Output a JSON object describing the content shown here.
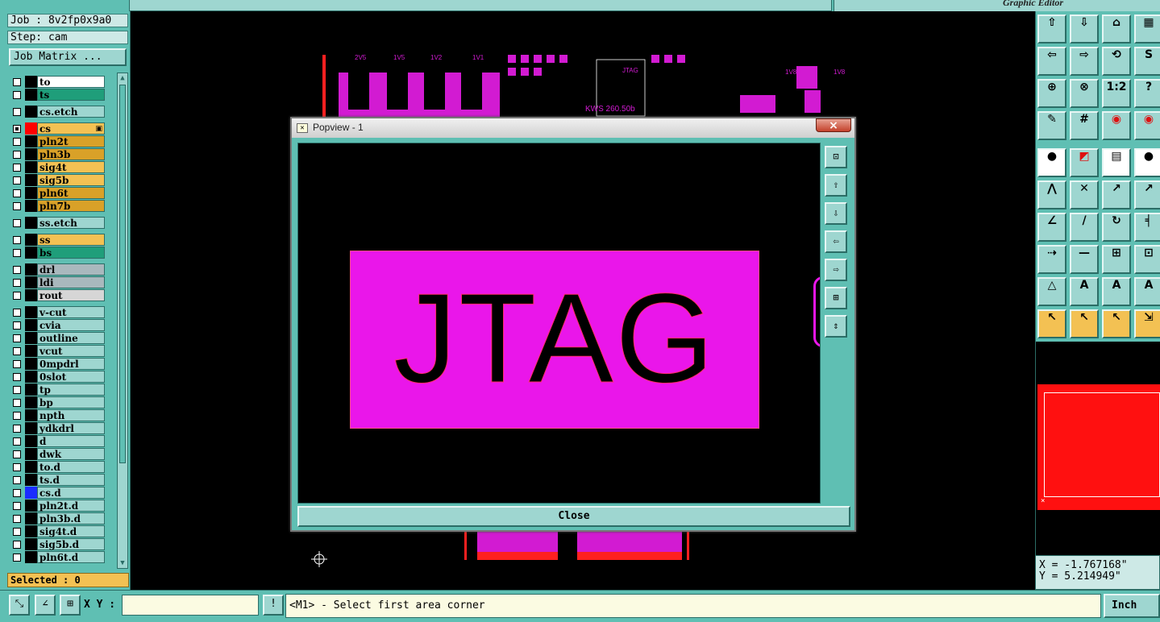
{
  "header": {
    "app_title": "Graphic Editor"
  },
  "job": {
    "job_label": "Job : 8v2fp0x9a0",
    "step_label": "Step: cam",
    "matrix_button": "Job Matrix ..."
  },
  "layers": [
    {
      "name": "to",
      "color": "#ffffff",
      "swatch": "#000000",
      "checked": false
    },
    {
      "name": "ts",
      "color": "#1f9e7a",
      "swatch": "#000000",
      "checked": false
    },
    {
      "name": "cs.etch",
      "color": "#9ed6d0",
      "swatch": "#000000",
      "checked": false
    },
    {
      "name": "cs",
      "color": "#f3c153",
      "swatch": "#ff0000",
      "checked": true,
      "flag": "▣"
    },
    {
      "name": "pln2t",
      "color": "#d9a128",
      "swatch": "#000000",
      "checked": false
    },
    {
      "name": "pln3b",
      "color": "#d9a128",
      "swatch": "#000000",
      "checked": false
    },
    {
      "name": "sig4t",
      "color": "#f3c153",
      "swatch": "#000000",
      "checked": false
    },
    {
      "name": "sig5b",
      "color": "#f3c153",
      "swatch": "#000000",
      "checked": false
    },
    {
      "name": "pln6t",
      "color": "#d9a128",
      "swatch": "#000000",
      "checked": false
    },
    {
      "name": "pln7b",
      "color": "#d9a128",
      "swatch": "#000000",
      "checked": false
    },
    {
      "name": "ss.etch",
      "color": "#9ed6d0",
      "swatch": "#000000",
      "checked": false
    },
    {
      "name": "ss",
      "color": "#f3c153",
      "swatch": "#000000",
      "checked": false
    },
    {
      "name": "bs",
      "color": "#1f9e7a",
      "swatch": "#000000",
      "checked": false
    },
    {
      "name": "drl",
      "color": "#a9b8bd",
      "swatch": "#000000",
      "checked": false
    },
    {
      "name": "ldi",
      "color": "#a9b8bd",
      "swatch": "#000000",
      "checked": false
    },
    {
      "name": "rout",
      "color": "#d6d6d6",
      "swatch": "#000000",
      "checked": false
    },
    {
      "name": "v-cut",
      "color": "#9ed6d0",
      "swatch": "#000000",
      "checked": false
    },
    {
      "name": "cvia",
      "color": "#9ed6d0",
      "swatch": "#000000",
      "checked": false
    },
    {
      "name": "outline",
      "color": "#9ed6d0",
      "swatch": "#000000",
      "checked": false
    },
    {
      "name": "vcut",
      "color": "#9ed6d0",
      "swatch": "#000000",
      "checked": false
    },
    {
      "name": "0mpdrl",
      "color": "#9ed6d0",
      "swatch": "#000000",
      "checked": false
    },
    {
      "name": "0slot",
      "color": "#9ed6d0",
      "swatch": "#000000",
      "checked": false
    },
    {
      "name": "tp",
      "color": "#9ed6d0",
      "swatch": "#000000",
      "checked": false
    },
    {
      "name": "bp",
      "color": "#9ed6d0",
      "swatch": "#000000",
      "checked": false
    },
    {
      "name": "npth",
      "color": "#9ed6d0",
      "swatch": "#000000",
      "checked": false
    },
    {
      "name": "ydkdrl",
      "color": "#9ed6d0",
      "swatch": "#000000",
      "checked": false
    },
    {
      "name": "d",
      "color": "#9ed6d0",
      "swatch": "#000000",
      "checked": false
    },
    {
      "name": "dwk",
      "color": "#9ed6d0",
      "swatch": "#000000",
      "checked": false
    },
    {
      "name": "to.d",
      "color": "#9ed6d0",
      "swatch": "#000000",
      "checked": false
    },
    {
      "name": "ts.d",
      "color": "#9ed6d0",
      "swatch": "#000000",
      "checked": false
    },
    {
      "name": "cs.d",
      "color": "#9ed6d0",
      "swatch": "#1a2dff",
      "checked": false
    },
    {
      "name": "pln2t.d",
      "color": "#9ed6d0",
      "swatch": "#000000",
      "checked": false
    },
    {
      "name": "pln3b.d",
      "color": "#9ed6d0",
      "swatch": "#000000",
      "checked": false
    },
    {
      "name": "sig4t.d",
      "color": "#9ed6d0",
      "swatch": "#000000",
      "checked": false
    },
    {
      "name": "sig5b.d",
      "color": "#9ed6d0",
      "swatch": "#000000",
      "checked": false
    },
    {
      "name": "pln6t.d",
      "color": "#9ed6d0",
      "swatch": "#000000",
      "checked": false
    }
  ],
  "selected_label": "Selected : 0",
  "board": {
    "silk_labels": [
      "2V5",
      "1V5",
      "1V2",
      "1V1",
      "JTAG",
      "KWS 260.50b",
      "1V8D",
      "1V8A"
    ]
  },
  "popview": {
    "title": "Popview - 1",
    "close_x": "×",
    "jtag_text": "JTAG",
    "close_label": "Close",
    "tool_icons": [
      "zoom-window-icon",
      "pan-up-icon",
      "pan-down-icon",
      "pan-left-icon",
      "pan-right-icon",
      "zoom-home-icon",
      "zoom-fit-icon"
    ]
  },
  "toolbar": {
    "glyphs": [
      "⇧",
      "⇩",
      "⌂",
      "▦",
      "⇦",
      "⇨",
      "⟲",
      "S",
      "⊕",
      "⊗",
      "1:2",
      "?",
      "✎",
      "#",
      "◉",
      "◉",
      "●",
      "◩",
      "▤",
      "●",
      "⋀",
      "✕",
      "↗",
      "↗",
      "∠",
      "/",
      "↻",
      "╡",
      "⇢",
      "—",
      "⊞",
      "⊡",
      "△",
      "A",
      "A",
      "A",
      "↖",
      "↖",
      "↖",
      "⇲"
    ],
    "names": [
      "pan-up-tool",
      "pan-down-tool",
      "home-tool",
      "grid-tool",
      "pan-left-tool",
      "pan-right-tool",
      "redraw-tool",
      "snap-tool",
      "zoom-fit-tool",
      "zoom-in-tool",
      "scale-tool",
      "help-tool",
      "measure-tool",
      "grid-toggle-tool",
      "net-tool",
      "net-highlight-tool",
      "pad-tool",
      "fill-tool",
      "ruler-tool",
      "dot-tool",
      "route-tool",
      "cross-tool",
      "line-tool",
      "arrow-tool",
      "angle-tool",
      "slash-tool",
      "rotate-tool",
      "flip-tool",
      "move-tool",
      "dash-tool",
      "box-tool",
      "group-tool",
      "triangle-tool",
      "text-tool",
      "text-alt-tool",
      "text-style-tool",
      "select-tool",
      "select-box-tool",
      "select-poly-tool",
      "select-net-tool"
    ],
    "orange_indexes": [
      36,
      37,
      38,
      39
    ],
    "white_indexes": [
      16,
      18,
      19
    ],
    "red_indexes": [
      14,
      15,
      17
    ]
  },
  "overview": {
    "mark": "×"
  },
  "coords": {
    "x": "X = -1.767168\"",
    "y": "Y = 5.214949\""
  },
  "status": {
    "xy_label": "X Y :",
    "xy_value": "",
    "warn_icon": "!",
    "prompt": "<M1> - Select first area corner",
    "units": "Inch"
  }
}
